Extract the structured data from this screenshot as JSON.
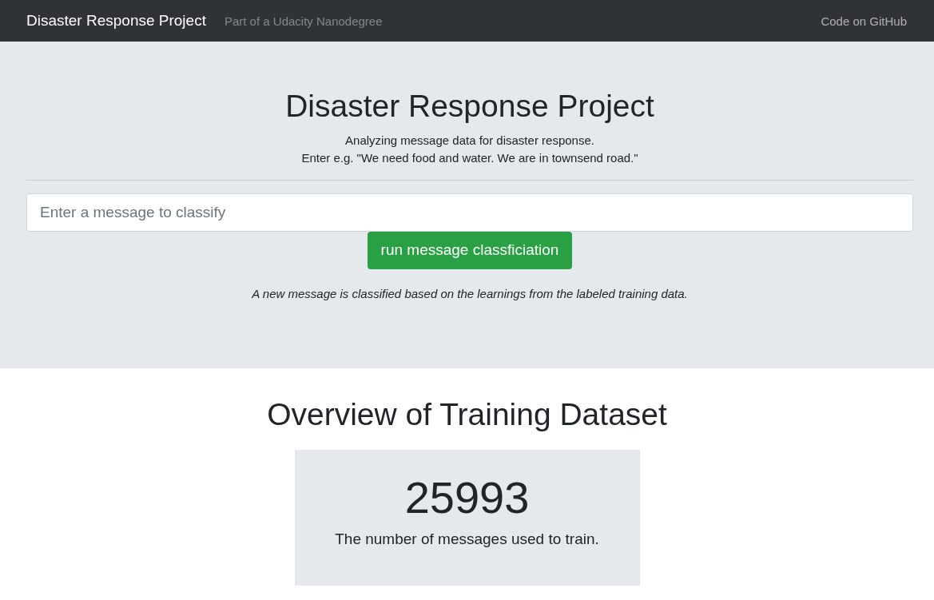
{
  "navbar": {
    "brand": "Disaster Response Project",
    "subtitle": "Part of a Udacity Nanodegree",
    "links": [
      "Code on GitHub"
    ]
  },
  "hero": {
    "title": "Disaster Response Project",
    "lines": [
      "Analyzing message data for disaster response.",
      "Enter e.g. \"We need food and water. We are in townsend road.\""
    ],
    "input": {
      "placeholder": "Enter a message to classify"
    },
    "button": "run message classficiation",
    "note": "A new message is classified based on the learnings from the labeled training data."
  },
  "overview": {
    "title": "Overview of Training Dataset",
    "stat": {
      "value": "25993",
      "caption": "The number of messages used to train."
    }
  }
}
